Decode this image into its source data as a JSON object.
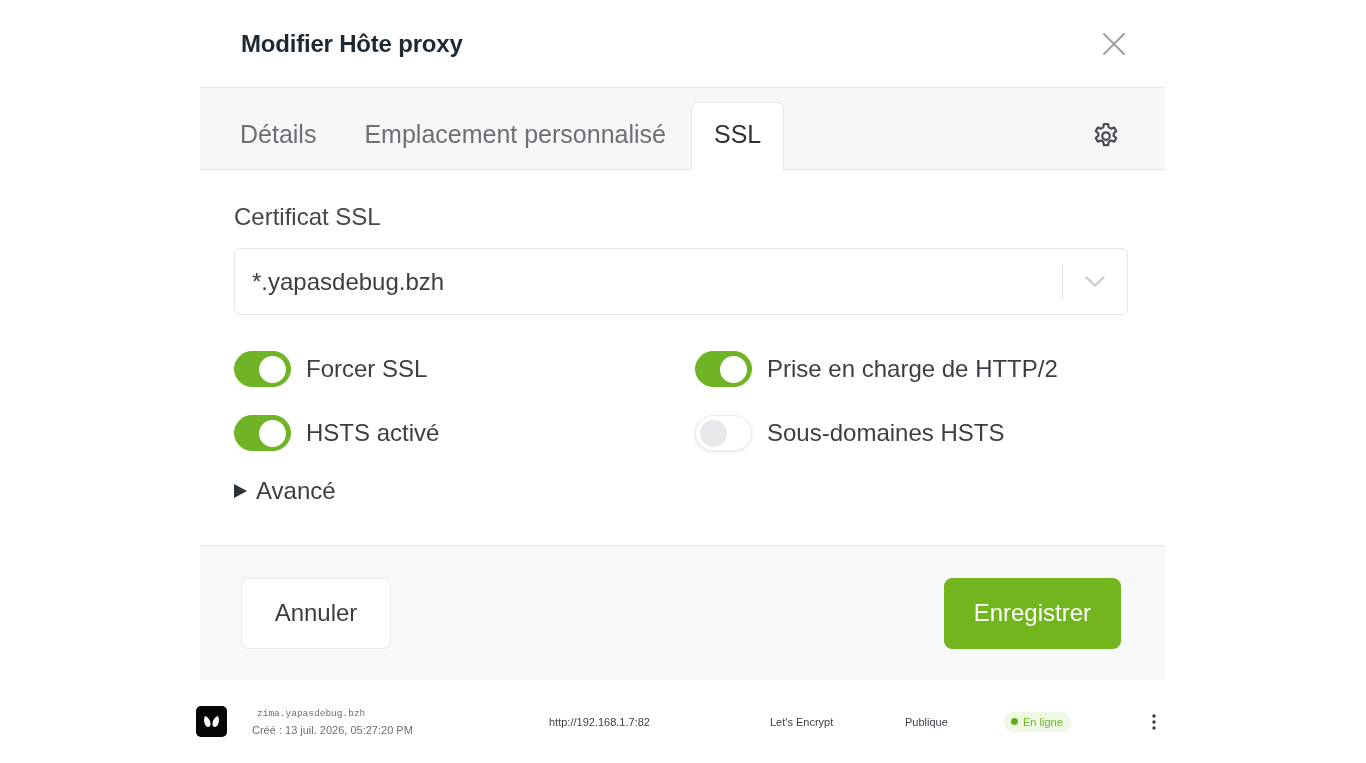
{
  "dialog": {
    "title": "Modifier Hôte proxy"
  },
  "tabs": [
    {
      "label": "Détails",
      "selected": false
    },
    {
      "label": "Emplacement personnalisé",
      "selected": false
    },
    {
      "label": "SSL",
      "selected": true
    }
  ],
  "ssl": {
    "certificate_label": "Certificat SSL",
    "certificate_value": "*.yapasdebug.bzh",
    "options": [
      {
        "label": "Forcer SSL",
        "on": true
      },
      {
        "label": "Prise en charge de HTTP/2",
        "on": true
      },
      {
        "label": "HSTS activé",
        "on": true
      },
      {
        "label": "Sous-domaines HSTS",
        "on": false
      }
    ],
    "advanced": {
      "label": "Avancé",
      "expanded": false
    }
  },
  "buttons": [
    {
      "label": "Annuler",
      "kind": "secondary"
    },
    {
      "label": "Enregistrer",
      "kind": "primary"
    }
  ],
  "host_row": {
    "domain": "zima.yapasdebug.bzh",
    "created": "Créé : 13 juil. 2026, 05:27:20 PM",
    "destination": "http://192.168.1.7:82",
    "ssl": "Let's Encrypt",
    "access": "Publique",
    "status": {
      "label": "En ligne",
      "online": true
    }
  }
}
